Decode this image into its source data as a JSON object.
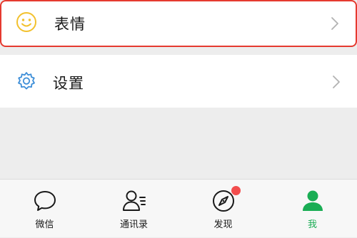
{
  "menu": {
    "items": [
      {
        "label": "表情",
        "icon": "smiley-face-icon",
        "icon_color": "#f2c12e"
      },
      {
        "label": "设置",
        "icon": "gear-icon",
        "icon_color": "#3d8ed8"
      }
    ],
    "highlight_color": "#e53a2f"
  },
  "tabbar": {
    "items": [
      {
        "label": "微信",
        "icon": "chat-bubble-icon",
        "active": false
      },
      {
        "label": "通讯录",
        "icon": "contacts-icon",
        "active": false
      },
      {
        "label": "发现",
        "icon": "compass-icon",
        "active": false,
        "badge": "red-dot"
      },
      {
        "label": "我",
        "icon": "person-icon",
        "active": true
      }
    ],
    "active_color": "#1aad54",
    "badge_color": "#f24d4d"
  }
}
